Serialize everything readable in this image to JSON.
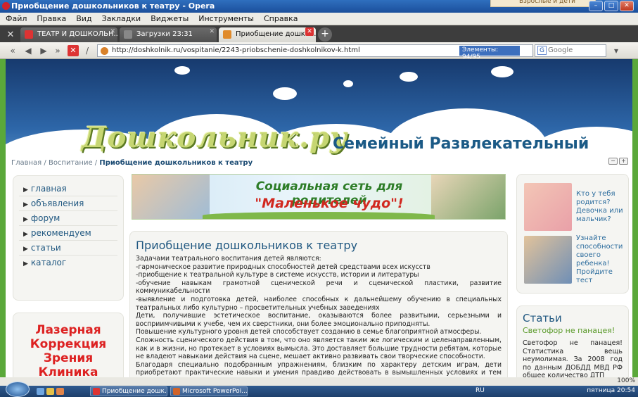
{
  "window": {
    "title": "Приобщение дошкольников к театру - Opera",
    "ad_peek": "Взрослые и дети"
  },
  "menu": [
    "Файл",
    "Правка",
    "Вид",
    "Закладки",
    "Виджеты",
    "Инструменты",
    "Справка"
  ],
  "tabs": [
    {
      "label": "ТЕАТР И ДОШКОЛЬН...",
      "active": false
    },
    {
      "label": "Загрузки 23:31",
      "active": false
    },
    {
      "label": "Приобщение дошко...",
      "active": true
    }
  ],
  "address": {
    "url": "http://doshkolnik.ru/vospitanie/2243-priobschenie-doshkolnikov-k.html",
    "blocked_label": "Элементы: 94/95",
    "search_placeholder": "Google"
  },
  "site": {
    "logo": "Дошкольник.ру",
    "slogan": "Семейный Развлекательный"
  },
  "breadcrumb": {
    "home": "Главная",
    "sep1": "/",
    "section": "Воспитание",
    "sep2": "/",
    "current": "Приобщение дошкольников к театру"
  },
  "left_menu": [
    "главная",
    "объявления",
    "форум",
    "рекомендуем",
    "статьи",
    "каталог"
  ],
  "left_ad": [
    "Лазерная",
    "Коррекция",
    "Зрения",
    "Клиника"
  ],
  "banner": {
    "line1": "Социальная сеть для родителей",
    "line2": "\"Маленькое чудо\"!"
  },
  "article": {
    "title": "Приобщение дошкольников к театру",
    "paragraphs": [
      "Задачами театрального воспитания детей являются:",
      "-гармоническое развитие природных способностей детей средствами всех искусств",
      "-приобщение к театральной культуре в системе искусств, истории и литературы",
      "-обучение навыкам грамотной сценической речи и сценической пластики, развитие коммуникабельности",
      "-выявление и подготовка детей, наиболее способных к дальнейшему обучению в специальных театральных либо культурно – просветительных учебных заведениях",
      "Дети, получившие эстетическое воспитание, оказываются более развитыми, серьезными и восприимчивыми к учебе, чем их сверстники, они более эмоционально приподняты.",
      "Повышение культурного уровня детей способствует созданию в семье благоприятной атмосферы.",
      "Сложность сценического действия в том, что оно является таким же логическим и целенаправленным, как и в жизни, но протекает в условиях вымысла. Это доставляет большие трудности ребятам, которые не владеют навыками действия на сцене, мешает активно развивать свои творческие способности.",
      "Благодаря специально подобранным упражнениям, близким по характеру детским играм, дети приобретают практические навыки и умения правдиво действовать в вымышленных условиях и тем самым подготавливают себя к работе над ролью..."
    ]
  },
  "right_promos": [
    {
      "text": "Кто у тебя родится? Девочка или мальчик?"
    },
    {
      "text": "Узнайте способности своего ребенка! Пройдите тест"
    }
  ],
  "articles_box": {
    "heading": "Статьи",
    "subheading": "Светофор не панацея!",
    "text": "Светофор не панацея! Статистика вещь неумолимая. За 2008 год по данным ДОБДД МВД РФ общее количество ДТП"
  },
  "status": {
    "zoom": "100%"
  },
  "taskbar": {
    "tasks": [
      "Приобщение дошк...",
      "Microsoft PowerPoi..."
    ],
    "lang": "RU",
    "clock": "пятница 20:54"
  }
}
